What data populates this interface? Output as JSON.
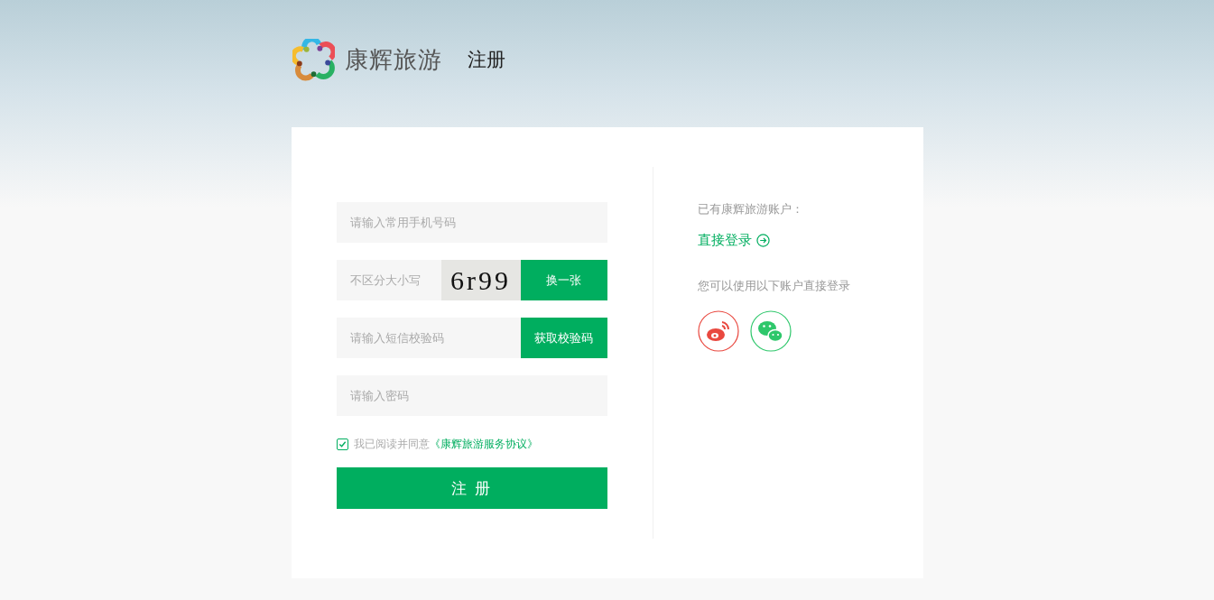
{
  "header": {
    "brand": "康辉旅游",
    "page_title": "注册"
  },
  "form": {
    "phone": {
      "placeholder": "请输入常用手机号码"
    },
    "captcha": {
      "placeholder": "不区分大小写",
      "captcha_text": "6r99",
      "button": "换一张"
    },
    "sms": {
      "placeholder": "请输入短信校验码",
      "button": "获取校验码"
    },
    "password": {
      "placeholder": "请输入密码"
    },
    "agreement": {
      "checked": true,
      "text": "我已阅读并同意",
      "link": "《康辉旅游服务协议》"
    },
    "submit": "注 册"
  },
  "aside": {
    "have_account": "已有康辉旅游账户：",
    "login_link": "直接登录",
    "social_hint": "您可以使用以下账户直接登录"
  }
}
